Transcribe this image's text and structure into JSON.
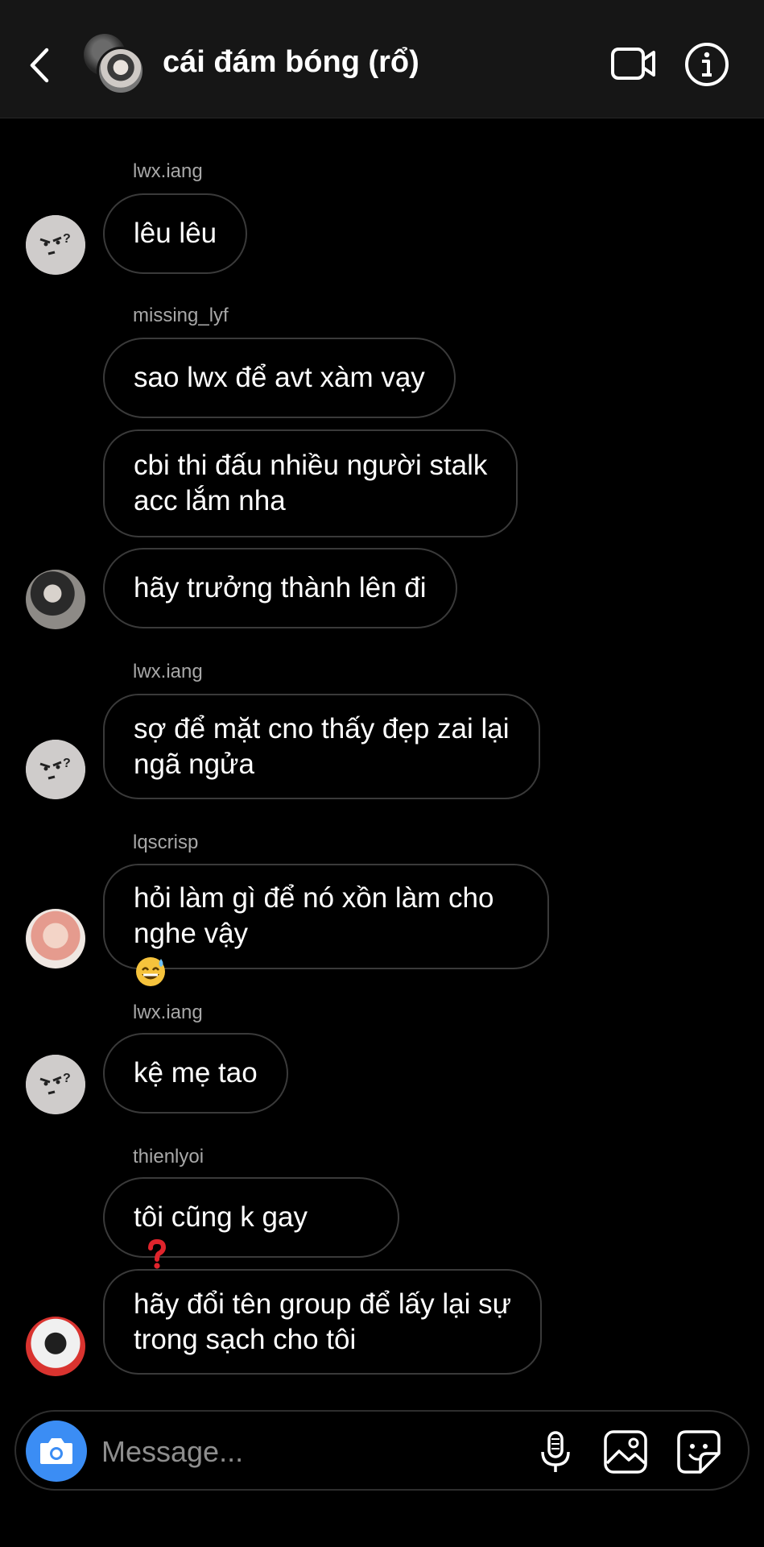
{
  "header": {
    "title": "cái đám bóng (rổ)",
    "back_icon": "chevron-left-icon",
    "video_icon": "video-camera-icon",
    "info_icon": "info-icon"
  },
  "messages": [
    {
      "sender": "lwx.iang",
      "text": "lêu lêu"
    },
    {
      "sender": "missing_lyf",
      "text": "sao lwx để avt xàm vạy"
    },
    {
      "sender": "",
      "text": "cbi thi đấu nhiều người stalk\nacc lắm nha"
    },
    {
      "sender": "",
      "text": "hãy trưởng thành lên đi"
    },
    {
      "sender": "lwx.iang",
      "text": "sợ để mặt cno thấy đẹp zai lại\nngã ngửa"
    },
    {
      "sender": "lqscrisp",
      "text": "hỏi làm gì để nó xồn làm cho\nnghe vậy"
    },
    {
      "sender": "lwx.iang",
      "text": "kệ mẹ tao"
    },
    {
      "sender": "thienlyoi",
      "text": "tôi cũng k gay"
    },
    {
      "sender": "",
      "text": "hãy đổi tên group để lấy lại sự\ntrong sạch cho tôi"
    }
  ],
  "composer": {
    "placeholder": "Message...",
    "camera_icon": "camera-icon",
    "mic_icon": "microphone-icon",
    "gallery_icon": "image-gallery-icon",
    "sticker_icon": "sticker-icon"
  },
  "colors": {
    "background": "#000000",
    "header_bg": "#161616",
    "bubble_border": "#3a3a3a",
    "sender_text": "#a8a8a8",
    "camera_blue": "#3b8df4"
  }
}
